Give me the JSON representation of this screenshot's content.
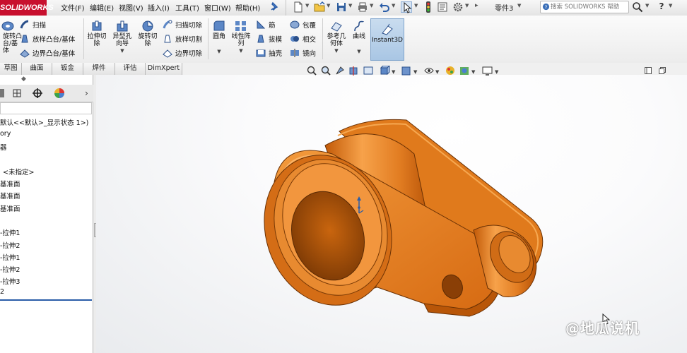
{
  "app": {
    "logo": "SOLIDWORKS",
    "document_name": "零件3"
  },
  "menus": [
    "文件(F)",
    "编辑(E)",
    "视图(V)",
    "插入(I)",
    "工具(T)",
    "窗口(W)",
    "帮助(H)"
  ],
  "help_search": {
    "placeholder": "搜索 SOLIDWORKS 帮助"
  },
  "commands": {
    "revolve_boss": "旋转凸台/基体",
    "sweep": "扫描",
    "loft_boss": "放样凸台/基体",
    "boundary_boss": "边界凸台/基体",
    "extruded_cut": "拉伸切除",
    "hole_wizard": "异型孔向导",
    "revolved_cut": "旋转切除",
    "swept_cut": "扫描切除",
    "lofted_cut": "放样切割",
    "boundary_cut": "边界切除",
    "fillet": "圆角",
    "linear_pattern": "线性阵列",
    "rib": "筋",
    "draft": "拔模",
    "shell": "抽壳",
    "wrap": "包覆",
    "intersect": "相交",
    "mirror": "镜向",
    "ref_geometry": "参考几何体",
    "curves": "曲线",
    "instant3d": "Instant3D"
  },
  "tabs": [
    "草图",
    "曲面",
    "钣金",
    "焊件",
    "评估",
    "DimXpert"
  ],
  "tree": {
    "items": [
      "默认<<默认>_显示状态 1>)",
      "ory",
      "器",
      "<未指定>",
      "基准面",
      "基准面",
      "基准面",
      "-拉伸1",
      "-拉伸2",
      "-拉伸1",
      "-拉伸2",
      "-拉伸3",
      "2"
    ]
  },
  "watermark": "@地瓜说机",
  "colors": {
    "logo_red": "#c8102e",
    "part_orange": "#e8791a",
    "highlight_blue": "#a9c6e4"
  }
}
